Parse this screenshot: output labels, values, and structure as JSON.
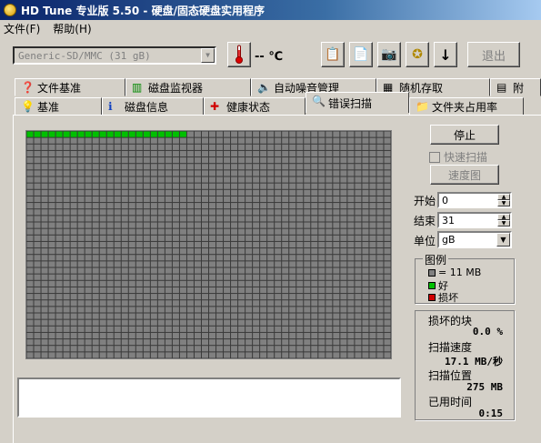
{
  "window": {
    "title": "HD Tune 专业版 5.50 - 硬盘/固态硬盘实用程序"
  },
  "menu": [
    {
      "label": "文件(F)"
    },
    {
      "label": "帮助(H)"
    }
  ],
  "toolbar": {
    "drive": "Generic-SD/MMC (31 gB)",
    "temperature": "-- ℃",
    "exit_label": "退出"
  },
  "tabs_row1": [
    {
      "label": "文件基准",
      "icon": "benchmark-icon"
    },
    {
      "label": "磁盘监视器",
      "icon": "monitor-icon"
    },
    {
      "label": "自动噪音管理",
      "icon": "speaker-icon"
    },
    {
      "label": "随机存取",
      "icon": "random-access-icon"
    },
    {
      "label": "附",
      "icon": "extra-icon"
    }
  ],
  "tabs_row2": [
    {
      "label": "基准",
      "icon": "lightbulb-icon"
    },
    {
      "label": "磁盘信息",
      "icon": "info-icon"
    },
    {
      "label": "健康状态",
      "icon": "cross-icon"
    },
    {
      "label": "错误扫描",
      "icon": "magnifier-icon",
      "active": true
    },
    {
      "label": "文件夹占用率",
      "icon": "folder-icon"
    }
  ],
  "scan": {
    "stop_label": "停止",
    "quick_scan_label": "快速扫描",
    "speed_map_label": "速度图",
    "start_label": "开始",
    "start_value": "0",
    "end_label": "结束",
    "end_value": "31",
    "unit_label": "单位",
    "unit_value": "gB",
    "grid_rows": 35,
    "grid_cols": 50,
    "scanned_blocks": 22
  },
  "legend": {
    "title": "图例",
    "block_size": "= 11 MB",
    "good": "好",
    "bad": "损坏",
    "colors": {
      "block": "#808080",
      "good": "#00c000",
      "bad": "#d00000"
    }
  },
  "stats": {
    "damaged_label": "损坏的块",
    "damaged_value": "0.0 %",
    "speed_label": "扫描速度",
    "speed_value": "17.1 MB/秒",
    "position_label": "扫描位置",
    "position_value": "275 MB",
    "elapsed_label": "已用时间",
    "elapsed_value": "0:15"
  }
}
